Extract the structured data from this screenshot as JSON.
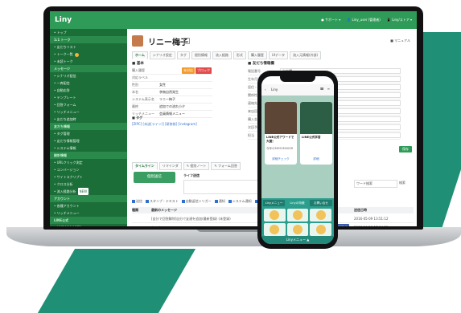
{
  "colors": {
    "brand_green": "#2f9b58",
    "sidebar_dark": "#1b6e38",
    "accent_teal": "#1f8f75",
    "phone_teal": "#2b9e8e"
  },
  "app": {
    "logo": "Liny",
    "topnav": [
      "● サポート ▾",
      "👤 Liny_user (管理者)",
      "📱 Liny/ストア ▾"
    ]
  },
  "sidebar": {
    "items": [
      {
        "label": "• トップ",
        "head": false
      },
      {
        "label": "1:1 トーク",
        "head": true
      },
      {
        "label": "• 友だちリスト",
        "head": false
      },
      {
        "label": "• トーク一覧",
        "head": false,
        "badge": true
      },
      {
        "label": "• 未読トーク",
        "head": false
      },
      {
        "label": "メッセージ",
        "head": true
      },
      {
        "label": "• シナリオ配信",
        "head": false
      },
      {
        "label": "• 一斉配信",
        "head": false
      },
      {
        "label": "• 自動応答",
        "head": false
      },
      {
        "label": "• テンプレート",
        "head": false
      },
      {
        "label": "• 回答フォーム",
        "head": false
      },
      {
        "label": "• リッチメニュー",
        "head": false
      },
      {
        "label": "• 友だち追加時",
        "head": false
      },
      {
        "label": "友だち情報",
        "head": true
      },
      {
        "label": "• タグ管理",
        "head": false
      },
      {
        "label": "• 友だち情報管理",
        "head": false
      },
      {
        "label": "• システム情報",
        "head": false
      },
      {
        "label": "統計情報",
        "head": true
      },
      {
        "label": "• URLクリック測定",
        "head": false
      },
      {
        "label": "• コンバージョン",
        "head": false
      },
      {
        "label": "• サイトスクリプト",
        "head": false
      },
      {
        "label": "• クロス分析",
        "head": false
      },
      {
        "label": "• 流入経路分析",
        "head": false,
        "tag": "NEW"
      },
      {
        "label": "アカウント",
        "head": true
      },
      {
        "label": "• 各種アカウント",
        "head": false
      },
      {
        "label": "• リッチメニュー",
        "head": false
      },
      {
        "label": "LINE公式",
        "head": true
      },
      {
        "label": "• LINE MANAGER",
        "head": false
      },
      {
        "label": "• アカウント管理",
        "head": false
      },
      {
        "label": "• スタッフ管理",
        "head": false
      }
    ]
  },
  "profile": {
    "name": "リニー梅子",
    "manual": "■ マニュアル"
  },
  "tabs_top": [
    "ホーム",
    "シナリオ設定",
    "タグ",
    "個別情報",
    "流入経路",
    "形式",
    "購入履歴",
    "UIデータ",
    "流入元情報(外部)"
  ],
  "info_section": {
    "title": "■ 基本",
    "rows": [
      {
        "k": "購入履歴",
        "v": "",
        "pills": [
          "未対応",
          "ブロック"
        ]
      },
      {
        "k": "対応ラベル",
        "v": ""
      },
      {
        "k": "性別",
        "v": "女性"
      },
      {
        "k": "本名",
        "v": "李無自然発生"
      },
      {
        "k": "システム表示名",
        "v": "リニー梅子"
      },
      {
        "k": "最終",
        "v": "追加での流れ小夕"
      },
      {
        "k": "リッチメニュー",
        "v": "会員情報メニュー"
      }
    ],
    "tag_title": "■ タグ",
    "tag_value": "[ZIPC] [未送(ライン)] [研修前] [instagram]"
  },
  "friend_section": {
    "title": "■ 友だち情報欄",
    "rows": [
      {
        "k": "電話番号",
        "v": "自由欄"
      },
      {
        "k": "生年月日",
        "v": "未設定"
      },
      {
        "k": "居住・都市",
        "v": ""
      },
      {
        "k": "関係性",
        "v": ""
      },
      {
        "k": "連絡先",
        "v": ""
      },
      {
        "k": "来店回数",
        "v": ""
      },
      {
        "k": "購入金額",
        "v": ""
      },
      {
        "k": "次回予約",
        "v": ""
      },
      {
        "k": "担当",
        "v": ""
      }
    ],
    "save": "保存"
  },
  "tabs_bottom": [
    "タイムライン",
    "リマインダ",
    "✎ 個別ノート",
    "✎ フォーム回答"
  ],
  "send_button": "個別送信",
  "rich_label": "ライフ送信",
  "search_placeholder": "ワード検索",
  "search_button": "検索",
  "filters": [
    "送信",
    "スタンプ・テキスト",
    "自動返信トリガー",
    "通知",
    "システム通知",
    "再送信"
  ],
  "list_headers": [
    "種類",
    "最新のメッセージ",
    "",
    "送信日時"
  ],
  "messages": [
    {
      "type": "",
      "text": "[自分で回答解除]自分で友達を追加(最新登録) (未登録)",
      "badge": "",
      "time": "2016-05-09 13:51:12"
    },
    {
      "type": "",
      "text": "ぶつまーで",
      "badge": "友達登録",
      "time": "2016-04-21 17:14:51"
    }
  ],
  "phone": {
    "header_title": "Liny",
    "back": "‹",
    "cards": [
      {
        "title": "LINE公式アワードで大賞！",
        "desc": "今年のMESSENGER",
        "btn": "詳細チェック"
      },
      {
        "title": "LINE公式学習",
        "desc": "",
        "btn": "詳細"
      }
    ],
    "menu_tabs": [
      "Linyメニュー",
      "Linyの特徴",
      "お問い合せ"
    ],
    "footer": "Linyメニュー ▲"
  }
}
